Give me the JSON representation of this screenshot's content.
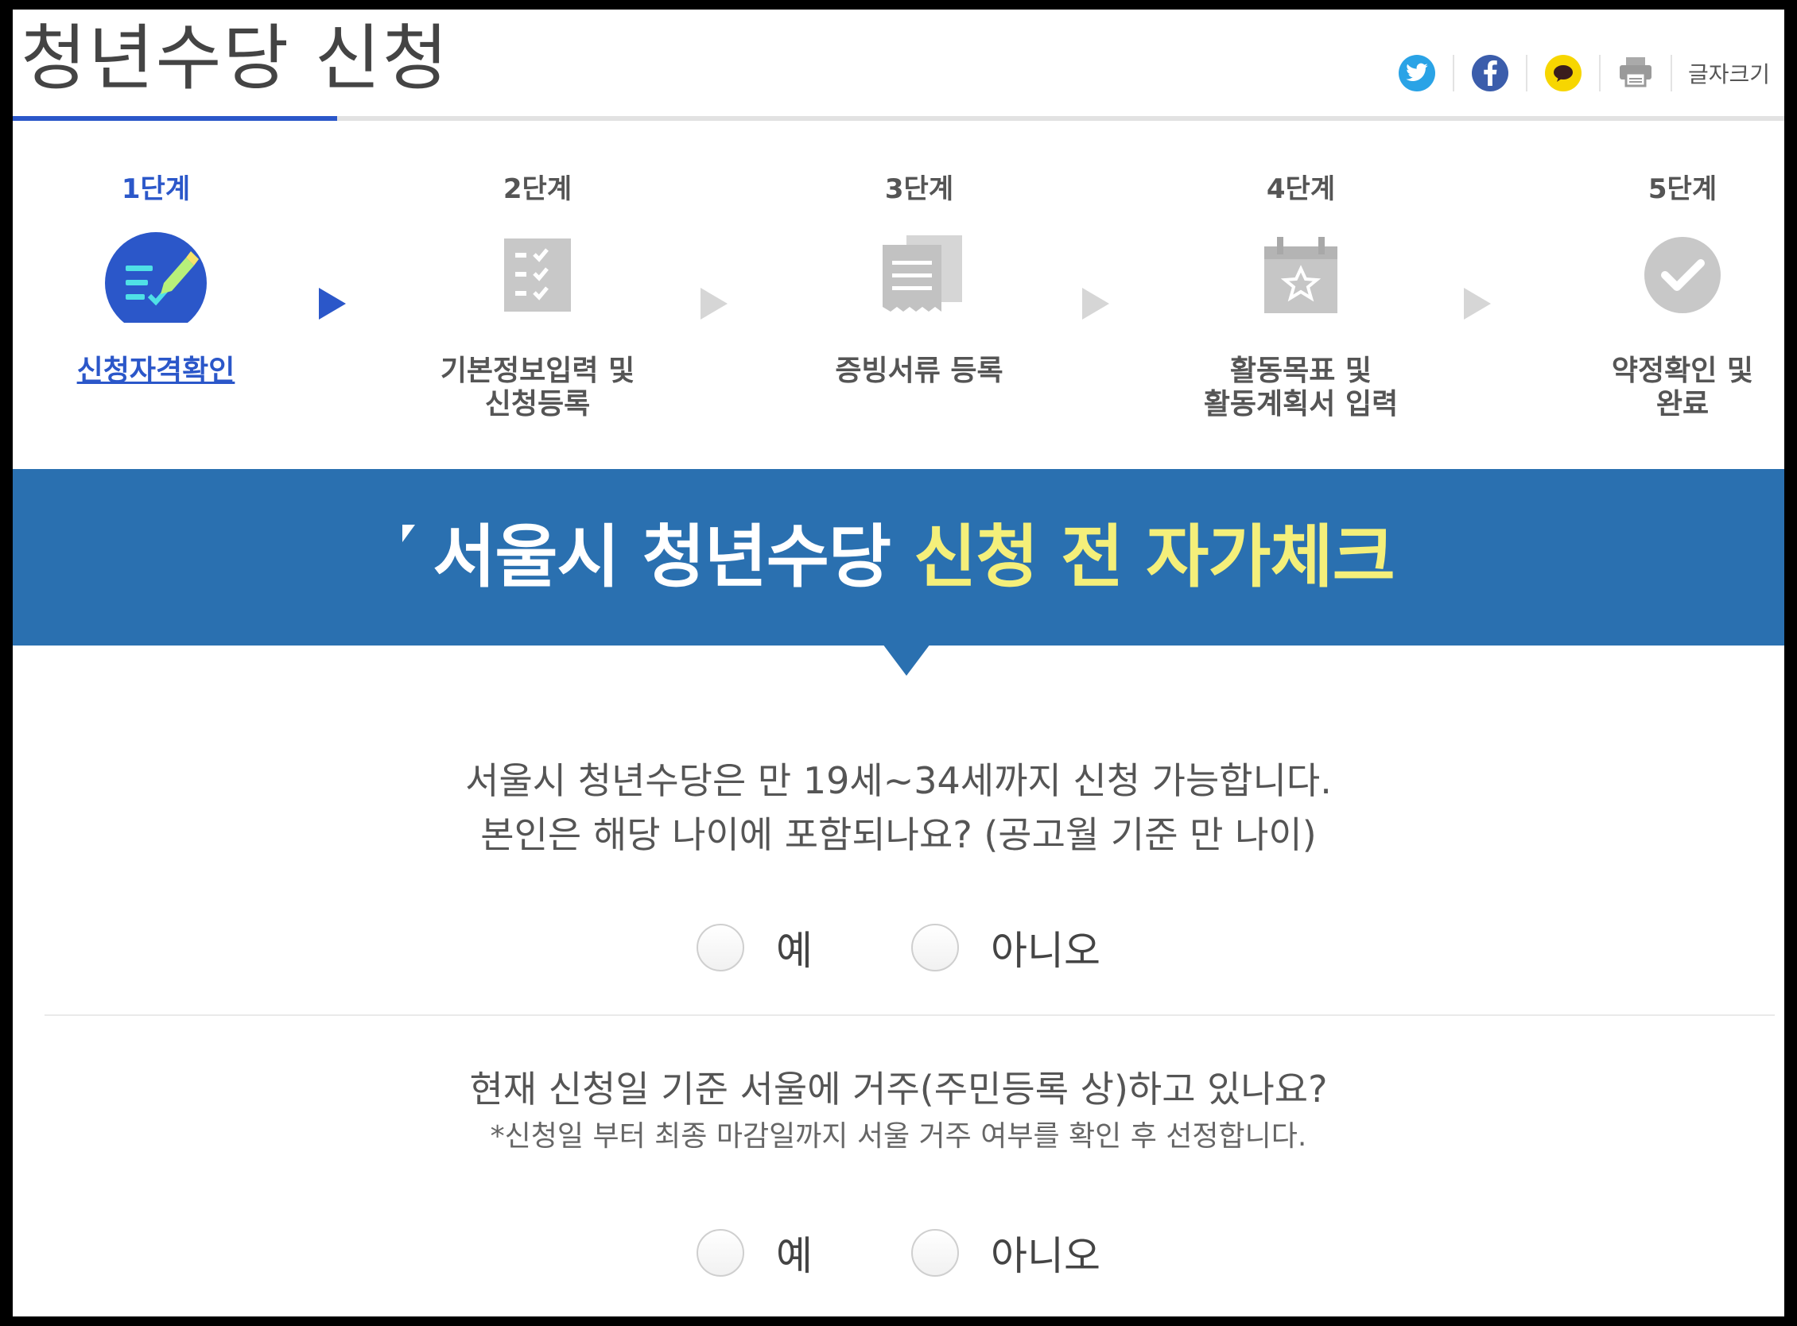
{
  "header": {
    "title": "청년수당 신청",
    "font_size_label": "글자크기",
    "share_icons": [
      "twitter-icon",
      "facebook-icon",
      "kakaotalk-icon",
      "print-icon"
    ]
  },
  "colors": {
    "accent": "#2b57c9",
    "banner": "#2a70b0",
    "highlight": "#f4ef7a",
    "inactive": "#d6d6d6"
  },
  "progress": {
    "active_step": 1,
    "total_steps": 5
  },
  "steps": [
    {
      "no": "1단계",
      "label_lines": [
        "신청자격확인"
      ],
      "icon": "checklist-pencil-icon",
      "active": true
    },
    {
      "no": "2단계",
      "label_lines": [
        "기본정보입력 및",
        "신청등록"
      ],
      "icon": "checklist-icon",
      "active": false
    },
    {
      "no": "3단계",
      "label_lines": [
        "증빙서류 등록"
      ],
      "icon": "documents-icon",
      "active": false
    },
    {
      "no": "4단계",
      "label_lines": [
        "활동목표 및",
        "활동계획서 입력"
      ],
      "icon": "calendar-star-icon",
      "active": false
    },
    {
      "no": "5단계",
      "label_lines": [
        "약정확인 및",
        "완료"
      ],
      "icon": "check-circle-icon",
      "active": false
    }
  ],
  "banner": {
    "text_main": "서울시 청년수당",
    "text_highlight": "신청 전 자가체크"
  },
  "questions": [
    {
      "lines": [
        "서울시 청년수당은 만 19세~34세까지 신청 가능합니다.",
        "본인은 해당 나이에 포함되나요? (공고월 기준 만 나이)"
      ],
      "note": "",
      "options": [
        "예",
        "아니오"
      ]
    },
    {
      "lines": [
        "현재 신청일 기준 서울에 거주(주민등록 상)하고 있나요?"
      ],
      "note": "*신청일 부터 최종 마감일까지 서울 거주 여부를 확인 후 선정합니다.",
      "options": [
        "예",
        "아니오"
      ]
    }
  ]
}
